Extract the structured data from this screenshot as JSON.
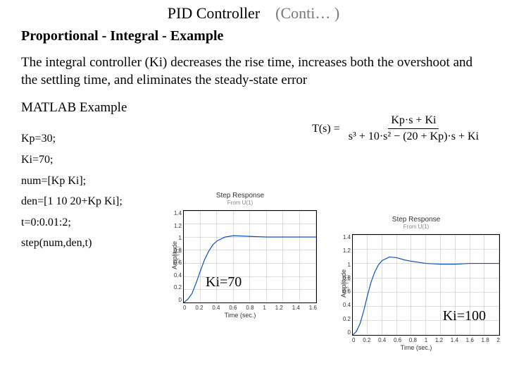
{
  "title_main": "PID Controller",
  "title_cont": "(Conti… )",
  "subtitle": "Proportional - Integral - Example",
  "body": "The integral controller (Ki) decreases the rise time, increases both the overshoot and the settling time, and eliminates the steady-state error",
  "matlab_label": "MATLAB Example",
  "code_lines": [
    "Kp=30;",
    "Ki=70;",
    "num=[Kp Ki];",
    "den=[1 10 20+Kp Ki];",
    "t=0:0.01:2;",
    "step(num,den,t)"
  ],
  "transfer_function": {
    "lhs": "T(s)  =",
    "numerator": "Kp·s  +  Ki",
    "denominator": "s³  +  10·s²  −  (20  +  Kp)·s  +  Ki"
  },
  "chart_data": [
    {
      "type": "line",
      "title": "Step Response",
      "subtitle": "From U(1)",
      "xlabel": "Time (sec.)",
      "ylabel": "Amplitude",
      "ysub": "To Y(1)",
      "xlim": [
        0,
        1.6
      ],
      "ylim": [
        0,
        1.4
      ],
      "xticks": [
        0,
        0.2,
        0.4,
        0.6,
        0.8,
        1,
        1.2,
        1.4,
        1.6
      ],
      "yticks": [
        0,
        0.2,
        0.4,
        0.6,
        0.8,
        1,
        1.2,
        1.4
      ],
      "annotation": "Ki=70",
      "x": [
        0,
        0.05,
        0.1,
        0.15,
        0.2,
        0.25,
        0.3,
        0.35,
        0.4,
        0.5,
        0.6,
        0.8,
        1.0,
        1.2,
        1.4,
        1.6
      ],
      "y": [
        0,
        0.05,
        0.14,
        0.3,
        0.48,
        0.65,
        0.78,
        0.88,
        0.94,
        1.0,
        1.02,
        1.01,
        1.0,
        1.0,
        1.0,
        1.0
      ]
    },
    {
      "type": "line",
      "title": "Step Response",
      "subtitle": "From U(1)",
      "xlabel": "Time (sec.)",
      "ylabel": "Amplitude",
      "ysub": "To Y(1)",
      "xlim": [
        0,
        2.0
      ],
      "ylim": [
        0,
        1.4
      ],
      "xticks": [
        0,
        0.2,
        0.4,
        0.6,
        0.8,
        1,
        1.2,
        1.4,
        1.6,
        1.8,
        2
      ],
      "yticks": [
        0,
        0.2,
        0.4,
        0.6,
        0.8,
        1,
        1.2,
        1.4
      ],
      "annotation": "Ki=100",
      "x": [
        0,
        0.05,
        0.1,
        0.15,
        0.2,
        0.25,
        0.3,
        0.35,
        0.4,
        0.5,
        0.6,
        0.7,
        0.8,
        1.0,
        1.2,
        1.4,
        1.6,
        1.8,
        2.0
      ],
      "y": [
        0,
        0.05,
        0.16,
        0.34,
        0.55,
        0.74,
        0.88,
        0.98,
        1.04,
        1.09,
        1.08,
        1.05,
        1.03,
        1.0,
        0.99,
        0.99,
        1.0,
        1.0,
        1.0
      ]
    }
  ]
}
